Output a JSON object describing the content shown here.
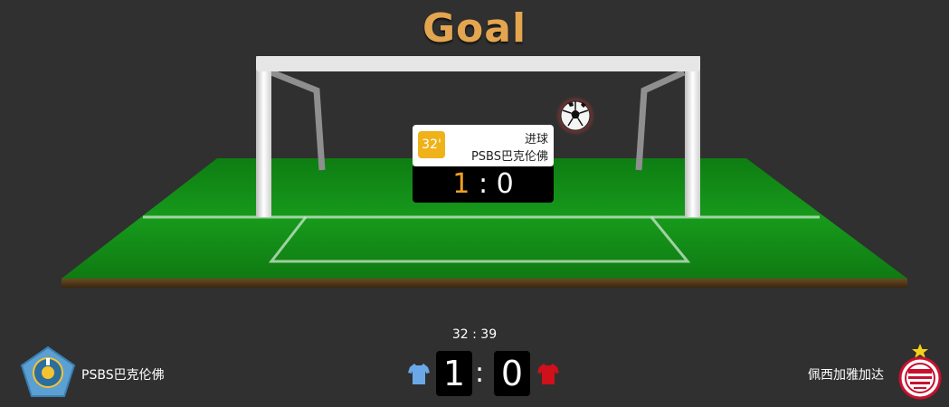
{
  "header": {
    "title": "Goal"
  },
  "event": {
    "minute": "32'",
    "type": "进球",
    "team": "PSBS巴克伦佛",
    "score_home": "1",
    "separator": ":",
    "score_away": "0"
  },
  "match": {
    "time": "32 : 39",
    "home": {
      "name": "PSBS巴克伦佛",
      "score": "1",
      "color": "#6aa8e8"
    },
    "away": {
      "name": "佩西加雅加达",
      "score": "0",
      "color": "#d0101a"
    },
    "separator": ":"
  },
  "icons": [
    "soccer-ball-icon",
    "home-team-logo",
    "away-team-logo",
    "home-shirt-icon",
    "away-shirt-icon"
  ],
  "colors": {
    "background": "#303030",
    "grass": "#1a8a1a",
    "title": "#e3a54f",
    "badge": "#f0b21a"
  }
}
